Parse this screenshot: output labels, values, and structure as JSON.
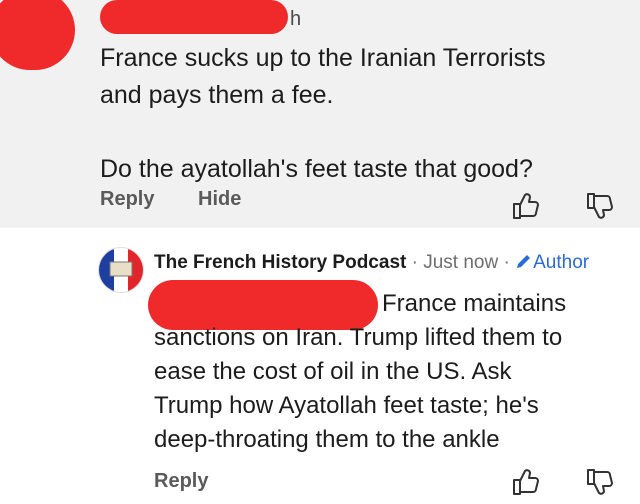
{
  "comment": {
    "time": "h",
    "lines": [
      "France sucks up to the Iranian Terrorists",
      "and pays them a fee.",
      "Do the ayatollah's feet taste that good?"
    ],
    "reply_label": "Reply",
    "hide_label": "Hide"
  },
  "reply": {
    "author_name": "The French History Podcast",
    "separator1": " · ",
    "time": "Just now",
    "separator2": " · ",
    "author_badge": "Author",
    "lines": [
      "France maintains",
      "sanctions on Iran. Trump lifted them to",
      "ease the cost of oil in the US. Ask",
      "Trump how Ayatollah feet taste; he's",
      "deep-throating them to the ankle"
    ],
    "reply_label": "Reply"
  },
  "icons": {
    "like": "thumbs-up-icon",
    "dislike": "thumbs-down-icon",
    "author": "pencil-icon"
  },
  "colors": {
    "comment_bg": "#f1f1f1",
    "author_accent": "#2a6ad9",
    "redaction": "#f02a2a"
  }
}
